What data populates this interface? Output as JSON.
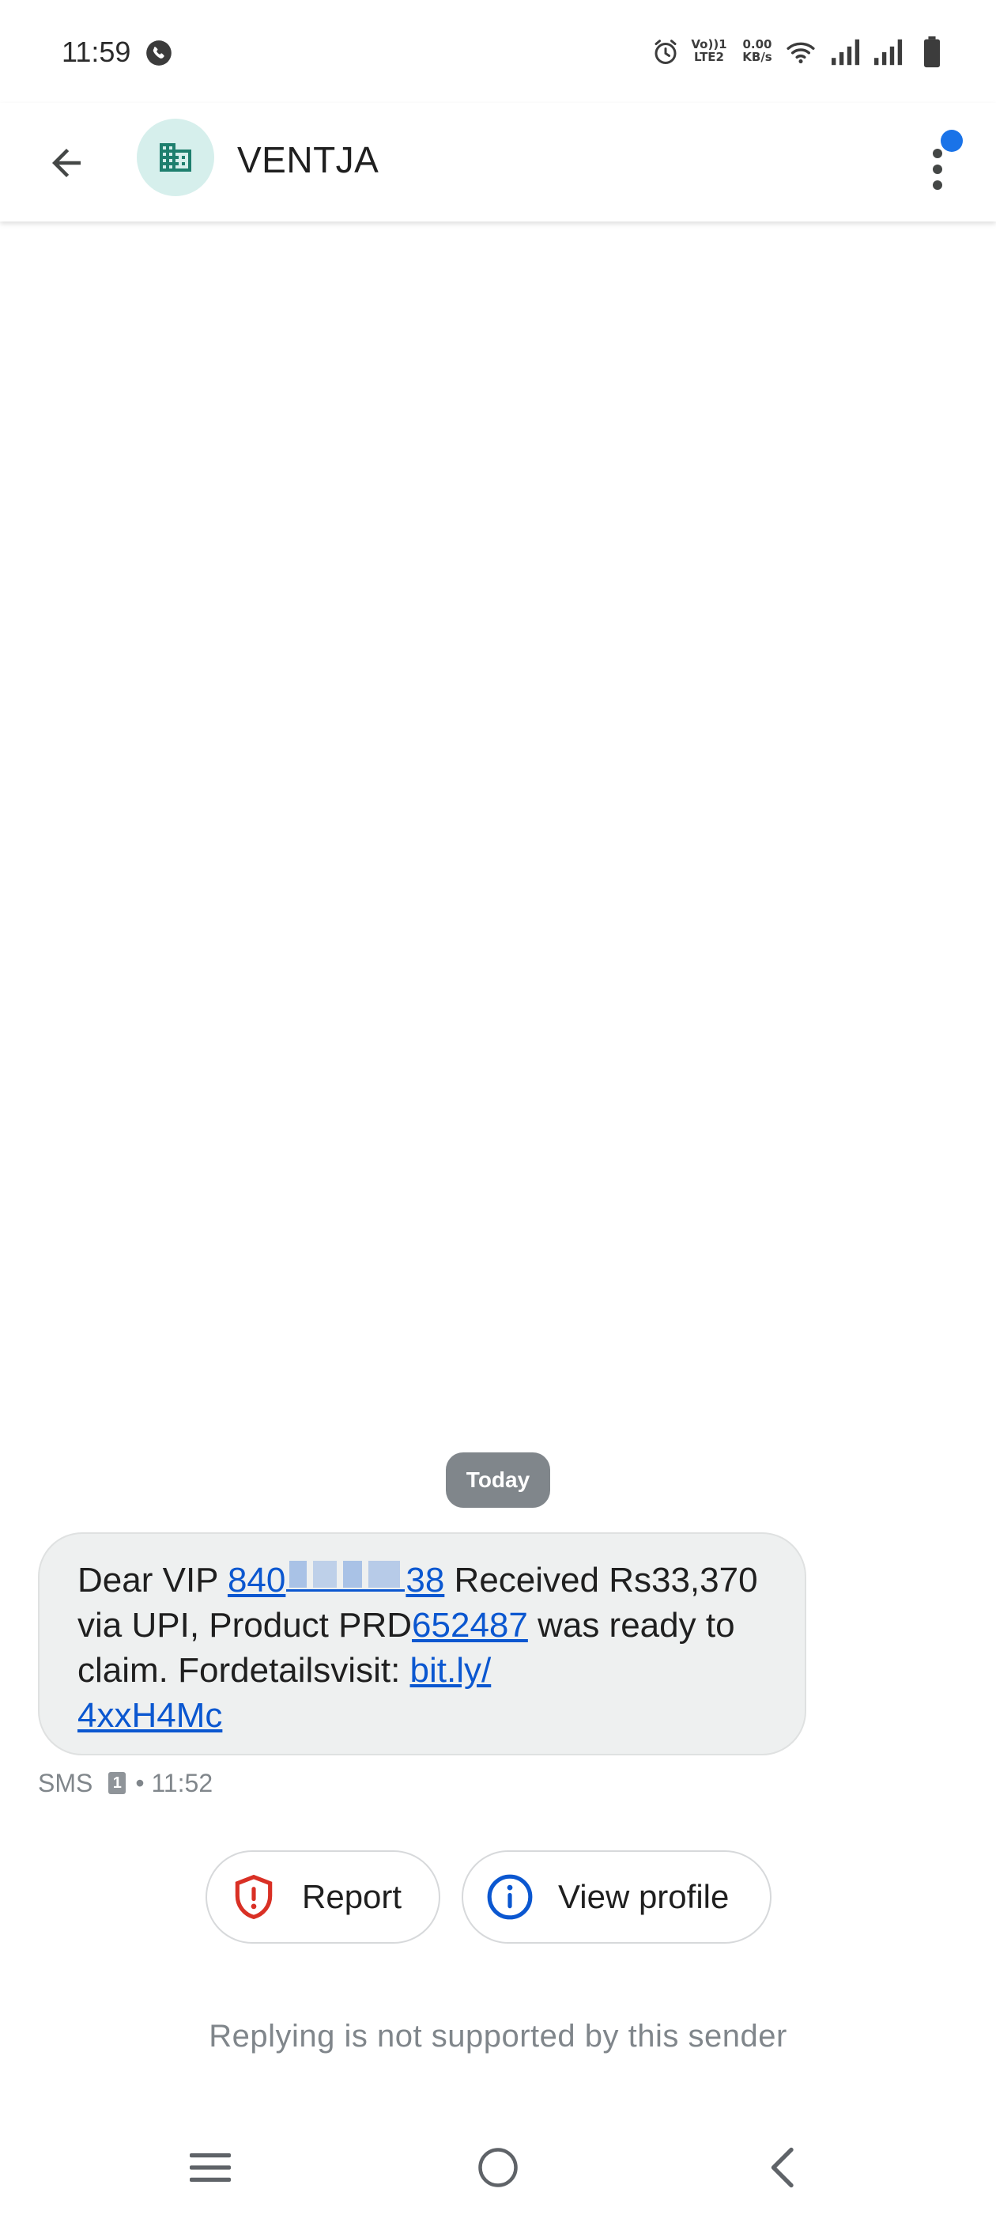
{
  "status_bar": {
    "time": "11:59",
    "icons": [
      "call-recording-icon",
      "alarm-icon",
      "volte-lte2-icon",
      "network-speed-icon",
      "wifi-icon",
      "signal-sim1-icon",
      "signal-sim2-icon",
      "battery-icon"
    ],
    "volte_line1": "Vo))1",
    "volte_line2": "LTE2",
    "speed_value": "0.00",
    "speed_unit": "KB/s"
  },
  "app_bar": {
    "sender": "VENTJA",
    "avatar_icon": "business-icon",
    "back_icon": "back-arrow-icon",
    "menu_icon": "more-vert-icon",
    "colors": {
      "avatar_bg": "#d6efec",
      "avatar_fg": "#1e7f6e",
      "notify_dot": "#1a73e8"
    }
  },
  "conversation": {
    "date_chip": "Today",
    "message": {
      "prefix": "Dear VIP ",
      "phone_start": "840",
      "phone_end": "38",
      "after_phone": " Received Rs33,370 via UPI, Product PRD",
      "product_id": "652487",
      "after_product": " was ready to claim. Fordetailsvisit: ",
      "link_part1": "bit.ly/",
      "link_part2": "4xxH4Mc"
    },
    "meta": {
      "channel": "SMS",
      "sim": "1",
      "time": "• 11:52"
    }
  },
  "actions": {
    "report_label": "Report",
    "view_profile_label": "View profile",
    "colors": {
      "report": "#d93025",
      "view_profile": "#0b57d0"
    }
  },
  "reply_note": "Replying is not supported by this sender",
  "nav_bar": {
    "icons": [
      "recents-menu-icon",
      "home-circle-icon",
      "back-chevron-icon"
    ]
  }
}
